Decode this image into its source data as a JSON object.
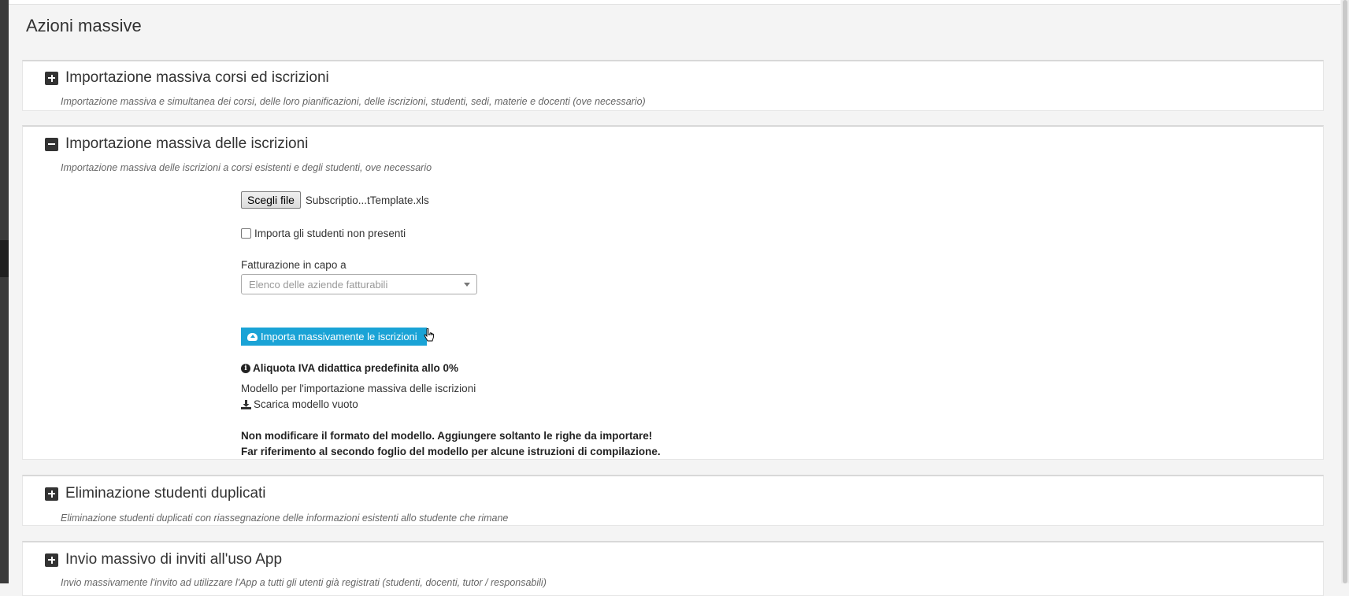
{
  "page": {
    "title": "Azioni massive"
  },
  "panels": [
    {
      "title": "Importazione massiva corsi ed iscrizioni",
      "description": "Importazione massiva e simultanea dei corsi, delle loro pianificazioni, delle iscrizioni, studenti, sedi, materie e docenti (ove necessario)",
      "expanded": false
    },
    {
      "title": "Importazione massiva delle iscrizioni",
      "description": "Importazione massiva delle iscrizioni a corsi esistenti e degli studenti, ove necessario",
      "expanded": true
    },
    {
      "title": "Eliminazione studenti duplicati",
      "description": "Eliminazione studenti duplicati con riassegnazione delle informazioni esistenti allo studente che rimane",
      "expanded": false
    },
    {
      "title": "Invio massivo di inviti all'uso App",
      "description": "Invio massivamente l'invito ad utilizzare l'App a tutti gli utenti già registrati (studenti, docenti, tutor / responsabili)",
      "expanded": false
    }
  ],
  "import_form": {
    "file_button": "Scegli file",
    "file_name": "Subscriptio...tTemplate.xls",
    "checkbox_label": "Importa gli studenti non presenti",
    "checkbox_checked": false,
    "billing_label": "Fatturazione in capo a",
    "billing_placeholder": "Elenco delle aziende fatturabili",
    "import_button": "Importa massivamente le iscrizioni",
    "vat_note": "Aliquota IVA didattica predefinita allo 0%",
    "template_label": "Modello per l'importazione massiva delle iscrizioni",
    "download_link": "Scarica modello vuoto",
    "warning_1": "Non modificare il formato del modello. Aggiungere soltanto le righe da importare!",
    "warning_2": "Far riferimento al secondo foglio del modello per alcune istruzioni di compilazione."
  },
  "colors": {
    "accent": "#1aa3d6",
    "text": "#333333",
    "background": "#f4f4f4"
  }
}
